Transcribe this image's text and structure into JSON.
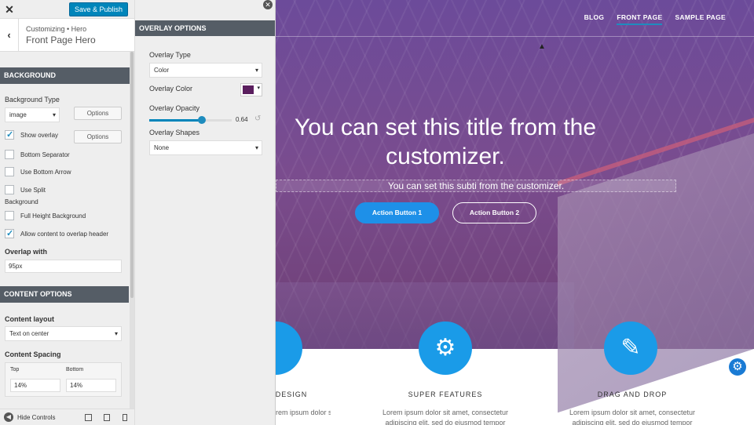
{
  "sidebar": {
    "publish_label": "Save & Publish",
    "crumb": "Customizing • Hero",
    "section_name": "Front Page Hero",
    "background_band": "BACKGROUND",
    "bg_type_label": "Background Type",
    "bg_type_value": "image",
    "options_label": "Options",
    "checkboxes": [
      {
        "label": "Show overlay",
        "checked": true
      },
      {
        "label": "Bottom Separator",
        "checked": false
      },
      {
        "label": "Use Bottom Arrow",
        "checked": false
      },
      {
        "label": "Use Split",
        "checked": false
      },
      {
        "label": "Full Height Background",
        "checked": false
      },
      {
        "label": "Allow content to overlap header",
        "checked": true
      }
    ],
    "split_extra": "Background",
    "overlap_label": "Overlap with",
    "overlap_value": "95px",
    "content_band": "CONTENT OPTIONS",
    "content_layout_label": "Content layout",
    "content_layout_value": "Text on center",
    "content_spacing_label": "Content Spacing",
    "top_label": "Top",
    "top_value": "14%",
    "bottom_label": "Bottom",
    "bottom_value": "14%",
    "hide_controls": "Hide Controls"
  },
  "overlay": {
    "band": "OVERLAY OPTIONS",
    "type_label": "Overlay Type",
    "type_value": "Color",
    "color_label": "Overlay Color",
    "color_hex": "#5a1e5e",
    "opacity_label": "Overlay Opacity",
    "opacity_value": "0.64",
    "shapes_label": "Overlay Shapes",
    "shapes_value": "None"
  },
  "preview": {
    "nav": [
      "BLOG",
      "FRONT PAGE",
      "SAMPLE PAGE"
    ],
    "hero_title": "You can set this title from the customizer.",
    "hero_subtitle": "You can set this subti  from the customizer.",
    "button1": "Action Button 1",
    "button2": "Action Button 2",
    "features": [
      {
        "title": "DESIGN",
        "text": "Lorem ipsum dolor sit amet, consectetur"
      },
      {
        "title": "SUPER FEATURES",
        "text": "Lorem ipsum dolor sit amet, consectetur adipiscing elit, sed do eiusmod tempor"
      },
      {
        "title": "DRAG AND DROP",
        "text": "Lorem ipsum dolor sit amet, consectetur adipiscing elit, sed do eiusmod tempor"
      }
    ]
  }
}
